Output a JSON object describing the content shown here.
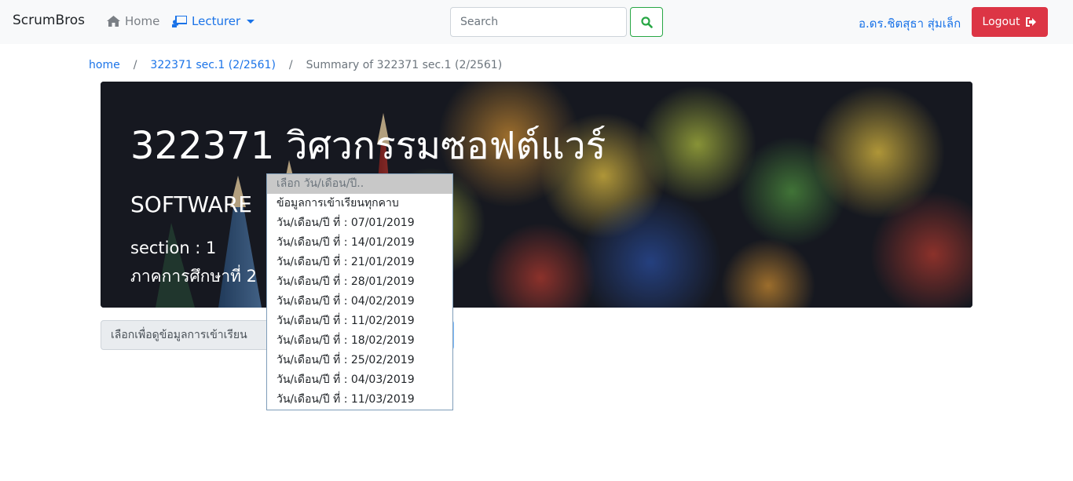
{
  "navbar": {
    "brand": "ScrumBros",
    "home_label": "Home",
    "lecturer_label": "Lecturer",
    "search_placeholder": "Search",
    "user_name": "อ.ดร.ชิตสุธา สุ่มเล็ก",
    "logout_label": "Logout"
  },
  "breadcrumb": {
    "items": [
      "home",
      "322371 sec.1 (2/2561)"
    ],
    "active": "Summary of 322371 sec.1 (2/2561)"
  },
  "hero": {
    "title": "322371 วิศวกรรมซอฟต์แวร์",
    "subtitle": "SOFTWARE",
    "section": "section : 1",
    "term": "ภาคการศึกษาที่ 2"
  },
  "attendance": {
    "label": "เลือกเพื่อดูข้อมูลการเข้าเรียน",
    "placeholder": "เลือก วัน/เดือน/ปี..",
    "options": [
      "ข้อมูลการเข้าเรียนทุกคาบ",
      "วัน/เดือน/ปี ที่ : 07/01/2019",
      "วัน/เดือน/ปี ที่ : 14/01/2019",
      "วัน/เดือน/ปี ที่ : 21/01/2019",
      "วัน/เดือน/ปี ที่ : 28/01/2019",
      "วัน/เดือน/ปี ที่ : 04/02/2019",
      "วัน/เดือน/ปี ที่ : 11/02/2019",
      "วัน/เดือน/ปี ที่ : 18/02/2019",
      "วัน/เดือน/ปี ที่ : 25/02/2019",
      "วัน/เดือน/ปี ที่ : 04/03/2019",
      "วัน/เดือน/ปี ที่ : 11/03/2019"
    ]
  },
  "colors": {
    "link": "#1a73e8",
    "danger": "#dc3545",
    "success": "#28a745"
  }
}
